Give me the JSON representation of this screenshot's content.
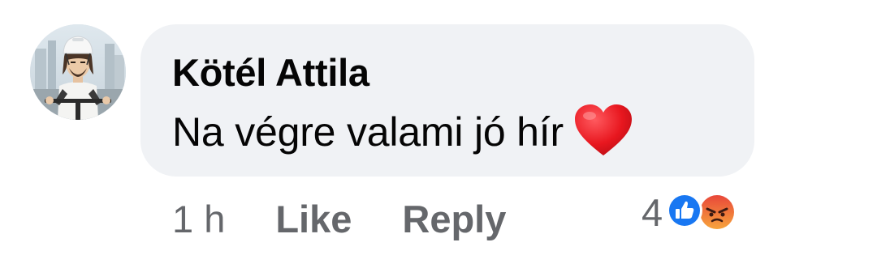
{
  "comment": {
    "author": "Kötél Attila",
    "text": "Na végre valami jó hír",
    "emoji_icon": "red-heart-icon",
    "time": "1 h",
    "like_label": "Like",
    "reply_label": "Reply",
    "reactions": {
      "count": "4",
      "icons": [
        "like-reaction-icon",
        "angry-reaction-icon"
      ]
    }
  },
  "colors": {
    "bubble_bg": "#f0f2f5",
    "text_primary": "#050505",
    "text_secondary": "#65676b",
    "like_blue": "#1877f2",
    "heart_red": "#e8171f",
    "angry_orange": "#f06a2c"
  }
}
